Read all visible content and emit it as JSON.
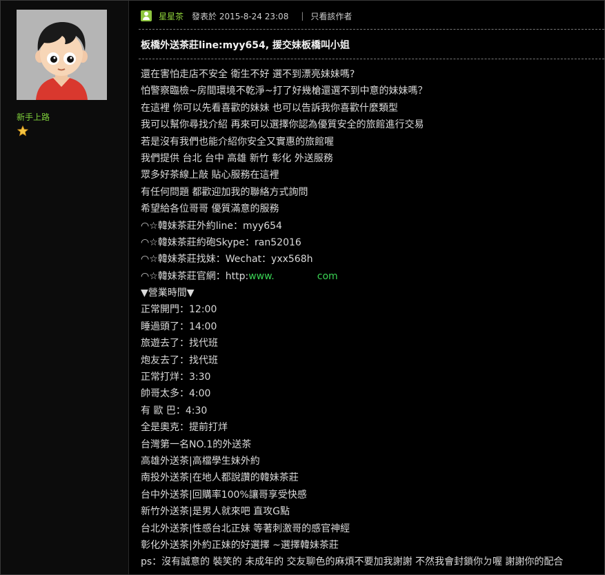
{
  "user": {
    "rank": "新手上路",
    "rank_icon": "star-icon"
  },
  "post": {
    "author": "星星茶",
    "posted_at": "發表於 2015-8-24 23:08",
    "separator": "|",
    "only_author_link": "只看該作者",
    "title": "板橋外送茶莊line:myy654, 援交妹板橋叫小姐",
    "lines": [
      "還在害怕走店不安全 衛生不好 選不到漂亮妹妹嗎?",
      "怕警察臨檢~房間環境不乾淨~打了好幾槍還選不到中意的妹妹嗎？",
      "在這裡 你可以先看喜歡的妹妹 也可以告訴我你喜歡什麼類型",
      "我可以幫你尋找介紹 再來可以選擇你認為優質安全的旅館進行交易",
      "若是沒有我們也能介紹你安全又實惠的旅館喔",
      "我們提供 台北 台中 高雄 新竹 彰化 外送服務",
      "眾多好茶線上敲 貼心服務在這裡",
      "有任何問題 都歡迎加我的聯絡方式詢問",
      "希望給各位哥哥 優質滿意的服務",
      "◠☆韓妹茶莊外約line：myy654",
      "◠☆韓妹茶莊約砲Skype：ran52016",
      "◠☆韓妹茶莊找妹：Wechat：yxx568h"
    ],
    "website_prefix": "◠☆韓妹茶莊官網：http:",
    "website_part1": "www.",
    "website_part2": "com",
    "lines2": [
      "▼營業時間▼",
      "正常開門：12:00",
      "睡過頭了：14:00",
      "旅遊去了：找代班",
      "炮友去了：找代班",
      "正常打烊：3:30",
      "帥哥太多：4:00",
      "有 歐 巴：4:30",
      "全是奧克：提前打烊",
      "台灣第一名NO.1的外送茶",
      "高雄外送茶|高檔學生妹外約",
      "南投外送茶|在地人都說讚的韓妹茶莊",
      "台中外送茶|回購率100%讓哥享受快感",
      "新竹外送茶|是男人就來吧 直攻G點",
      "台北外送茶|性感台北正妹 等著刺激哥的感官神經",
      "彰化外送茶|外約正妹的好選擇 ~選擇韓妹茶莊",
      "ps：沒有誠意的 裝笑的 未成年的 交友聊色的麻煩不要加我謝謝 不然我會封鎖你ㄉ喔 謝謝你的配合"
    ]
  },
  "colors": {
    "background": "#000000",
    "sidebar": "#0c0c0c",
    "accent_green": "#8fd33a",
    "link_green": "#39d353",
    "text": "#dadada"
  }
}
